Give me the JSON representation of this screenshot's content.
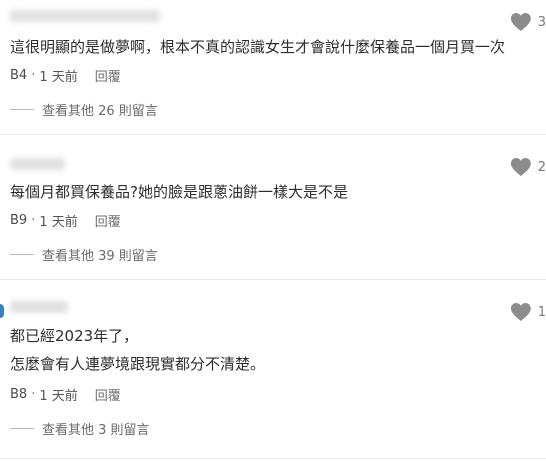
{
  "comments": [
    {
      "author": "",
      "like_count": "3",
      "lines": [
        "這很明顯的是做夢啊，根本不真的認識女生才會說什麼保養品一個月買一次"
      ],
      "floor": "B4",
      "time": "1 天前",
      "reply_label": "回覆",
      "view_replies": "查看其他 26 則留言"
    },
    {
      "author": "",
      "like_count": "2",
      "lines": [
        "每個月都買保養品?她的臉是跟蔥油餅一樣大是不是"
      ],
      "floor": "B9",
      "time": "1 天前",
      "reply_label": "回覆",
      "view_replies": "查看其他 39 則留言"
    },
    {
      "author": "",
      "like_count": "1",
      "lines": [
        "都已經2023年了，",
        "怎麼會有人連夢境跟現實都分不清楚。"
      ],
      "floor": "B8",
      "time": "1 天前",
      "reply_label": "回覆",
      "view_replies": "查看其他 3 則留言"
    }
  ],
  "separator": "·",
  "icons": {
    "like": "heart-icon"
  },
  "colors": {
    "heart": "#8c8c8c",
    "divider": "#e9e9e9",
    "avatar_accent": "#3b82c4"
  }
}
